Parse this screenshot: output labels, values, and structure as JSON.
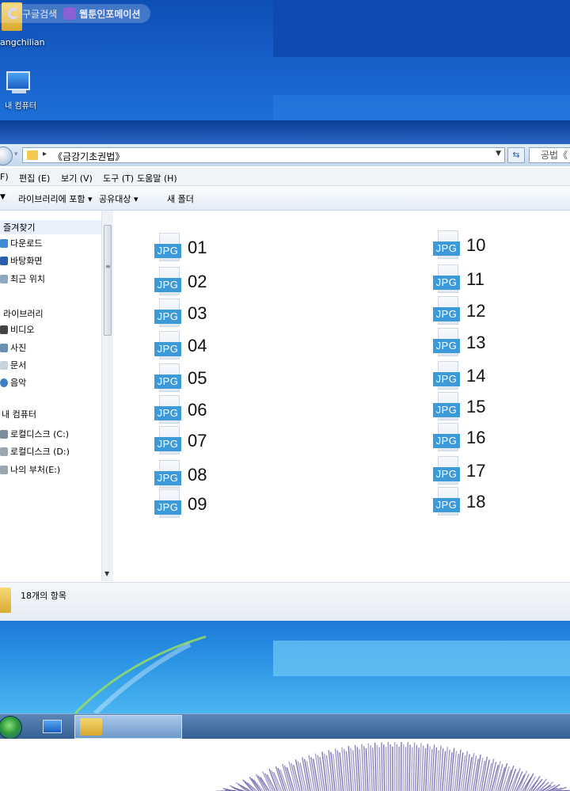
{
  "desktop": {
    "watermark_search": "구글검색",
    "watermark_brand": "웹툰인포메이션",
    "icons": [
      {
        "label": "angchilian",
        "icon": "user-folder-icon"
      },
      {
        "label": "내 컴퓨터",
        "icon": "computer-icon"
      }
    ]
  },
  "explorer": {
    "address_path": "《금강기초권법》",
    "search_placeholder": "공법《",
    "menu": [
      "F)",
      "편집 (E)",
      "보기 (V)",
      "도구 (T)",
      "도움말 (H)"
    ],
    "commands": [
      "라이브러리에 포함 ▾",
      "공유대상 ▾",
      "새 폴더"
    ],
    "nav": {
      "favorites": "즐겨찾기",
      "favorite_items": [
        "다운로드",
        "바탕화면",
        "최근 위치"
      ],
      "libraries": "라이브러리",
      "library_items": [
        "비디오",
        "사진",
        "문서",
        "음악"
      ],
      "computer": "내 컴퓨터",
      "drives": [
        "로컬디스크 (C:)",
        "로컬디스크 (D:)",
        "나의 부처(E:)"
      ]
    },
    "file_icon_label": "JPG",
    "files": [
      "01",
      "02",
      "03",
      "04",
      "05",
      "06",
      "07",
      "08",
      "09",
      "10",
      "11",
      "12",
      "13",
      "14",
      "15",
      "16",
      "17",
      "18"
    ],
    "status": "18개의 항목"
  },
  "colors": {
    "desktop_blue": "#1860c9",
    "jpg_band": "#3d9ad8",
    "taskbar": "#345f92",
    "fur_purple": "#6a5aa8"
  }
}
